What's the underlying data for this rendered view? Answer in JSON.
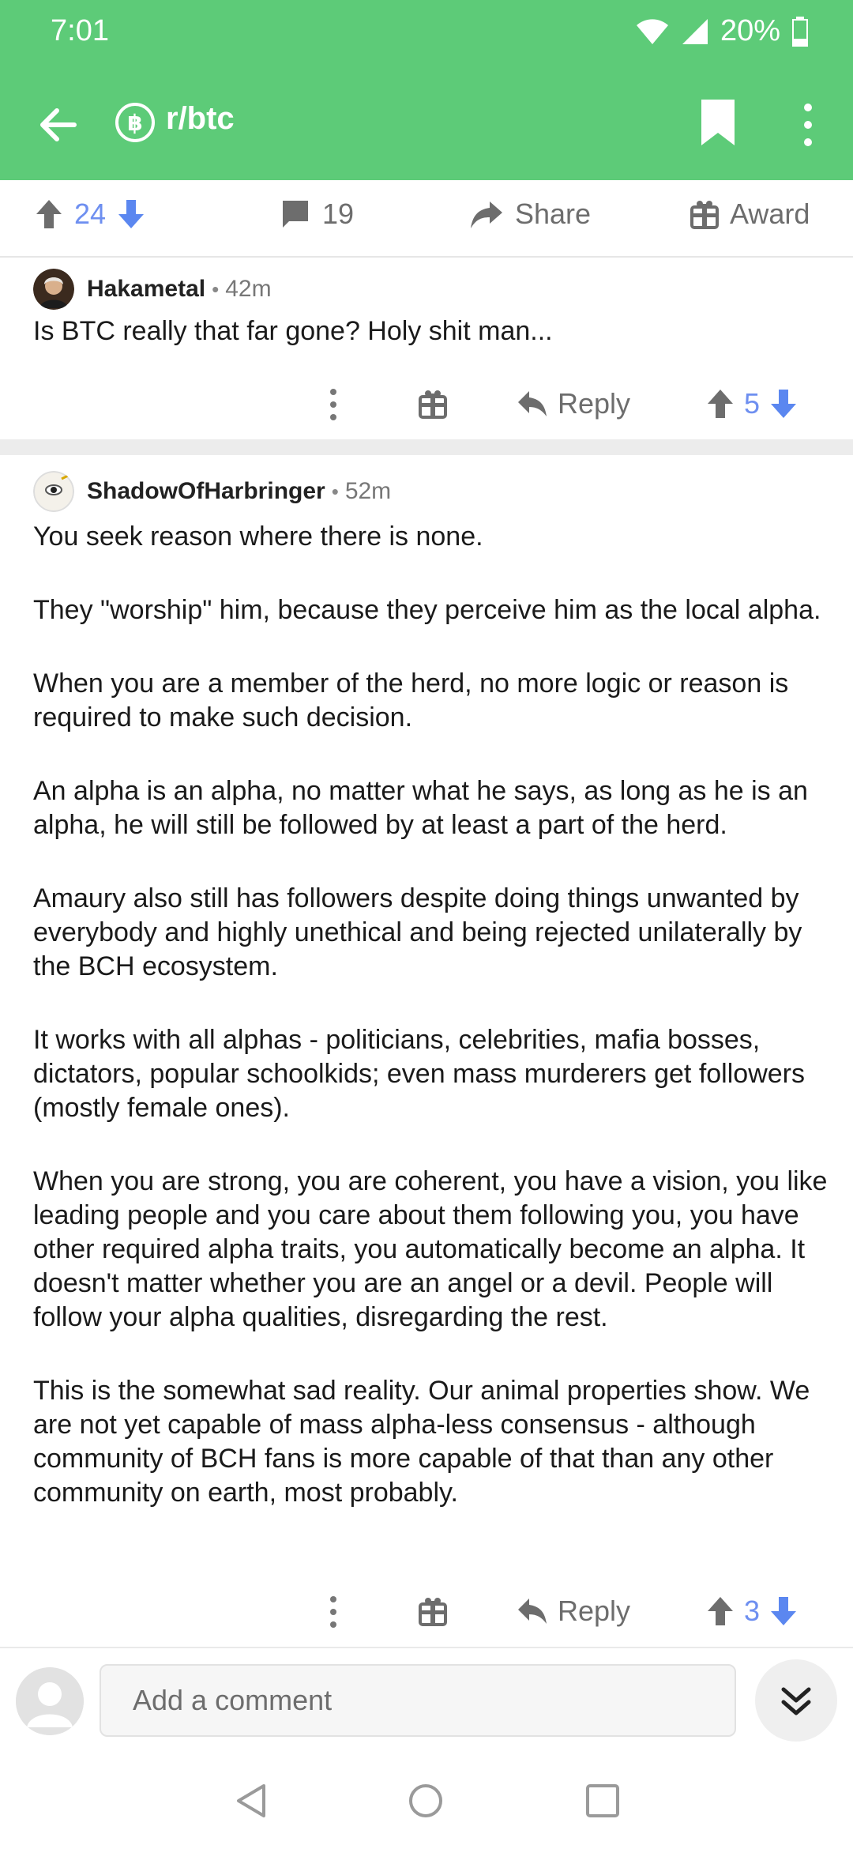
{
  "status": {
    "time": "7:01",
    "battery": "20%"
  },
  "header": {
    "subreddit": "r/btc",
    "subreddit_icon": "bitcoin-icon",
    "accent": "#5dcb78"
  },
  "post_actions": {
    "votes": "24",
    "comments": "19",
    "share": "Share",
    "award": "Award"
  },
  "comments": [
    {
      "username": "Hakametal",
      "age": "42m",
      "body": [
        "Is BTC really that far gone? Holy shit man..."
      ],
      "reply": "Reply",
      "votes": "5"
    },
    {
      "username": "ShadowOfHarbringer",
      "age": "52m",
      "body": [
        "You seek reason where there is none.",
        "They \"worship\" him, because they perceive him as the local alpha.",
        "When you are a member of the herd, no more logic or reason is required to make such decision.",
        "An alpha is an alpha, no matter what he says, as long as he is an alpha, he will still be followed by at least a part of the herd.",
        "Amaury also still has followers despite doing things unwanted by everybody and highly unethical and being rejected unilaterally by the BCH ecosystem.",
        "It works with all alphas - politicians, celebrities, mafia bosses, dictators, popular schoolkids; even mass murderers get followers (mostly female ones).",
        "When you are strong, you are coherent, you have a vision, you like leading people and you care about them following you, you have other required alpha traits, you automatically become an alpha. It doesn't matter whether you are an angel or a devil. People will follow your alpha qualities, disregarding the rest.",
        "This is the somewhat sad reality. Our animal properties show. We are not yet capable of mass alpha-less consensus - although community of BCH fans is more capable of that than any other community on earth, most probably."
      ],
      "reply": "Reply",
      "votes": "3"
    }
  ],
  "compose": {
    "placeholder": "Add a comment"
  },
  "colors": {
    "upvote": "#6d6d6d",
    "downvote": "#5b87f0",
    "vote_count": "#6e8ff0"
  }
}
